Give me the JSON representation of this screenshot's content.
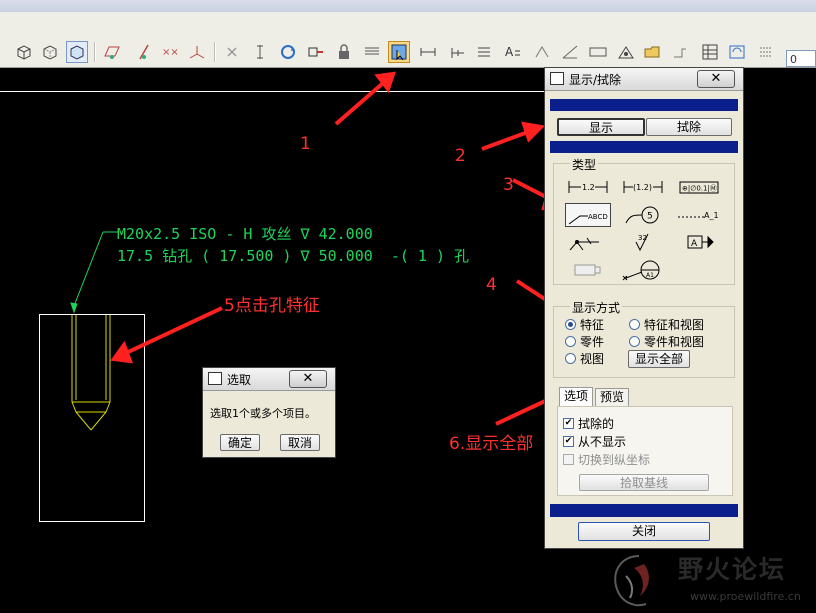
{
  "toolbar": {
    "icons": [
      "box-shaded-icon",
      "box-wire-icon",
      "box-hidden-icon",
      "box-nohidden-icon",
      "datum-plane-icon",
      "datum-axis-icon",
      "datum-point-icon",
      "csys-icon",
      "delete-icon",
      "dimension-icon",
      "refresh-icon",
      "move-icon",
      "lock-icon",
      "table-icon",
      "show-erase-icon",
      "dim-tool-icon",
      "ordinate-icon",
      "note-icon",
      "text-icon",
      "symbol-icon",
      "angle-icon",
      "block-icon",
      "view-icon",
      "folder-icon",
      "snap-icon",
      "grid-icon",
      "regen-icon",
      "settings-icon"
    ],
    "field_value": "0"
  },
  "drawing": {
    "note_line1": "M20x2.5 ISO - H 攻丝 ∇ 42.000",
    "note_line2": "17.5 钻孔 ( 17.500 ) ∇ 50.000  -( 1 ) 孔"
  },
  "annotations": {
    "step1": "1",
    "step2": "2",
    "step3": "3",
    "step4": "4",
    "step5": "5点击孔特征",
    "step6": "6.显示全部"
  },
  "select_dialog": {
    "title": "选取",
    "message": "选取1个或多个项目。",
    "ok": "确定",
    "cancel": "取消",
    "close": "✕"
  },
  "show_erase_dialog": {
    "title": "显示/拭除",
    "close": "✕",
    "show_tab": "显示",
    "erase_tab": "拭除",
    "type_label": "类型",
    "type_symbols": [
      "dimension",
      "ref-dimension",
      "geom-tolerance",
      "note",
      "balloon",
      "axis",
      "symbol",
      "surface-finish",
      "datum",
      "cosmetic",
      "datum-target"
    ],
    "type_texts": {
      "dim": "1.2",
      "refdim": "(1.2)",
      "gtol": "⊕|∅0.1|Ⓜ",
      "note": "ABCD",
      "balloon": "5",
      "axis": "A_1",
      "finish": "32",
      "datum": "A",
      "target": "A1"
    },
    "display_mode_label": "显示方式",
    "modes": [
      "特征",
      "特征和视图",
      "零件",
      "零件和视图",
      "视图"
    ],
    "selected_mode": "特征",
    "show_all": "显示全部",
    "tabs": [
      "选项",
      "预览"
    ],
    "options": [
      {
        "label": "拭除的",
        "checked": true,
        "enabled": true
      },
      {
        "label": "从不显示",
        "checked": true,
        "enabled": true
      },
      {
        "label": "切换到纵坐标",
        "checked": false,
        "enabled": false
      }
    ],
    "pick_baseline": "拾取基线",
    "close_button": "关闭"
  },
  "watermark": {
    "title": "野火论坛",
    "url": "www.proewildfire.cn"
  },
  "colors": {
    "note_green": "#1fd45a",
    "annotation_red": "#ff3030",
    "dialog_band_blue": "#0b1f8c",
    "dialog_bg": "#ece9d8"
  }
}
